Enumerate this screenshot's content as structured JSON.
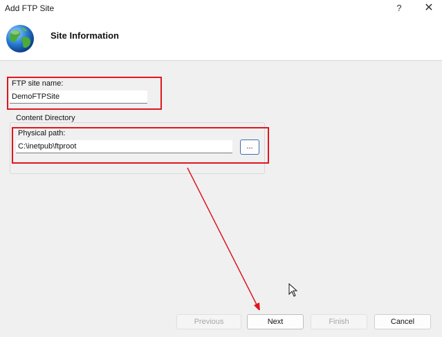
{
  "window": {
    "title": "Add FTP Site",
    "help_label": "?",
    "close_label": "✕"
  },
  "header": {
    "title": "Site Information",
    "icon": "globe-icon"
  },
  "form": {
    "site_name_label": "FTP site name:",
    "site_name_value": "DemoFTPSite",
    "content_directory_label": "Content Directory",
    "physical_path_label": "Physical path:",
    "physical_path_value": "C:\\inetpub\\ftproot",
    "browse_label": "..."
  },
  "footer": {
    "previous_label": "Previous",
    "next_label": "Next",
    "finish_label": "Finish",
    "cancel_label": "Cancel"
  },
  "colors": {
    "annotation_red": "#e0141e",
    "browse_border": "#3b6bb3"
  }
}
